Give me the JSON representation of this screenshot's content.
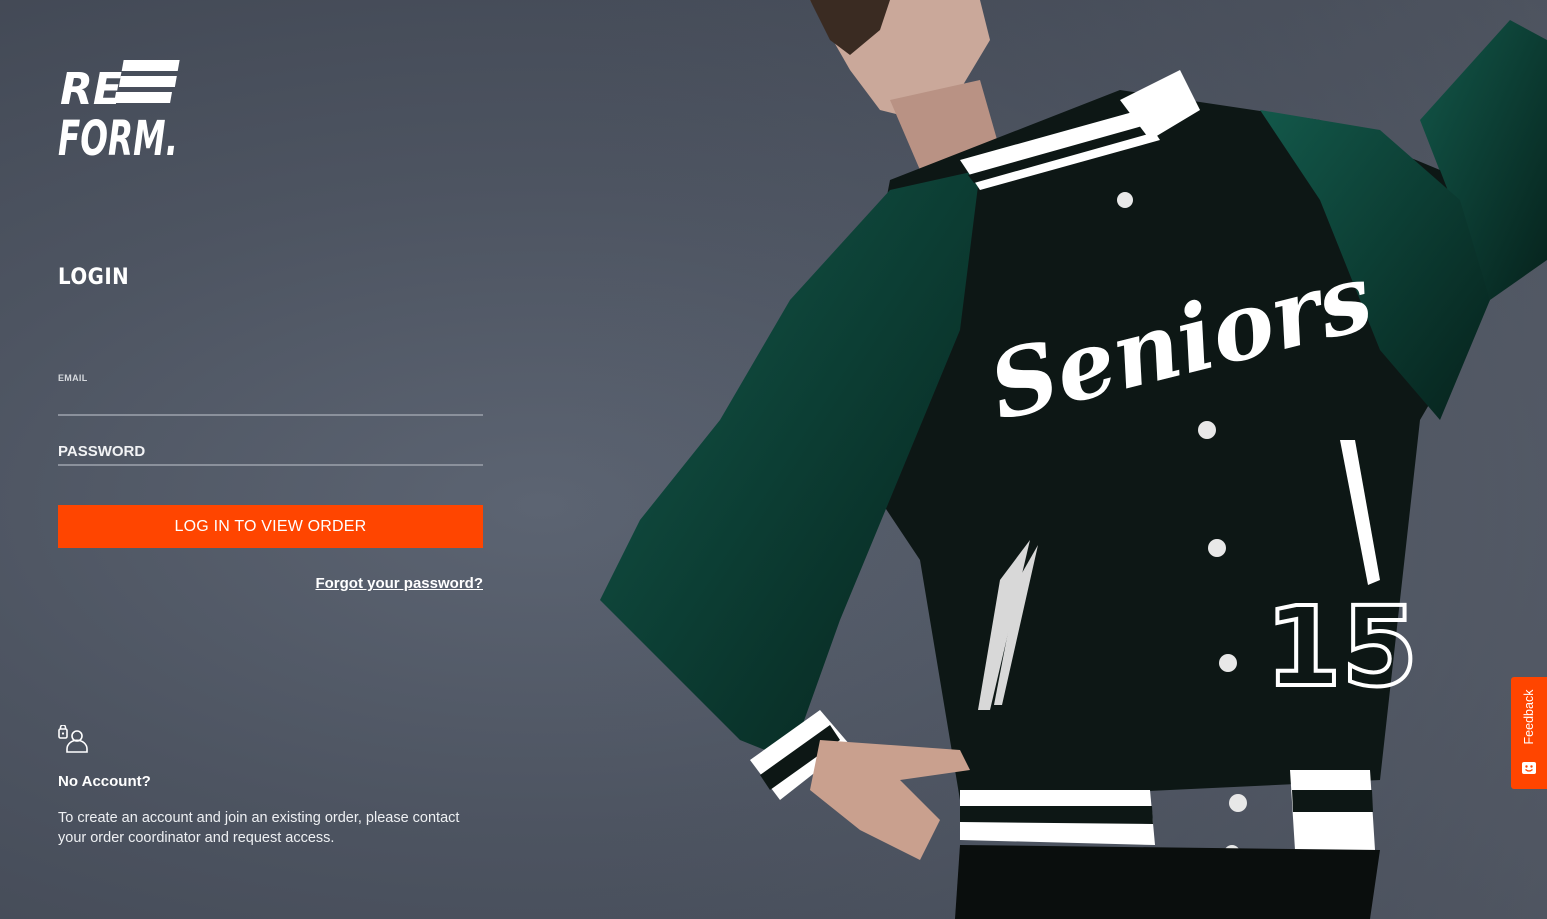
{
  "brand": {
    "logo_line1": "RE",
    "logo_line2": "FORM.",
    "accent": "#ff4500"
  },
  "login": {
    "title": "LOGIN",
    "email_label": "EMAIL",
    "email_value": "",
    "password_label": "PASSWORD",
    "password_value": "",
    "submit_label": "LOG IN TO VIEW ORDER",
    "forgot_label": "Forgot your password?"
  },
  "no_account": {
    "icon": "account-lock-icon",
    "title": "No Account?",
    "text": "To create an account and join an existing order, please contact your order coordinator and request access."
  },
  "hero": {
    "jacket_script": "Seniors",
    "jacket_number": "15",
    "jacket_colors": [
      "#0b1614",
      "#0f4a3a",
      "#ffffff"
    ]
  },
  "feedback": {
    "label": "Feedback",
    "icon": "feedback-face-icon",
    "color": "#ff4500"
  }
}
